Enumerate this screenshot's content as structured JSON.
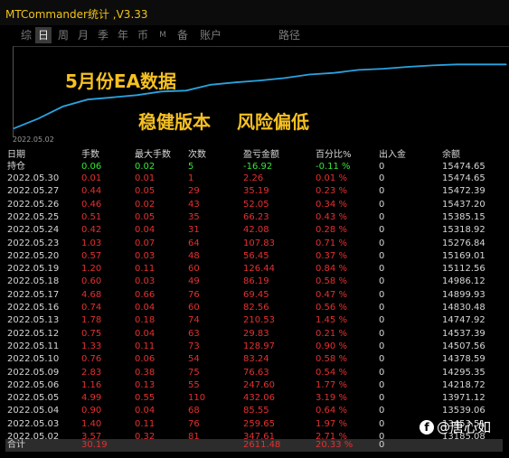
{
  "window": {
    "title": "MTCommander统计 ,V3.33"
  },
  "tabs": [
    {
      "label": "综",
      "active": false
    },
    {
      "label": "日",
      "active": true
    },
    {
      "label": "周",
      "active": false
    },
    {
      "label": "月",
      "active": false
    },
    {
      "label": "季",
      "active": false
    },
    {
      "label": "年",
      "active": false
    },
    {
      "label": "币",
      "active": false
    },
    {
      "label": "M",
      "active": false
    },
    {
      "label": "备",
      "active": false
    },
    {
      "label": "账户",
      "active": false
    },
    {
      "label": "路径",
      "active": false
    }
  ],
  "annotations": {
    "line1": "5月份EA数据",
    "line2a": "稳健版本",
    "line2b": "风险偏低"
  },
  "chart_data": {
    "type": "line",
    "x_start_label": "2022.05.02",
    "x": [
      "2022.05.02",
      "2022.05.03",
      "2022.05.04",
      "2022.05.05",
      "2022.05.06",
      "2022.05.09",
      "2022.05.10",
      "2022.05.11",
      "2022.05.12",
      "2022.05.13",
      "2022.05.16",
      "2022.05.17",
      "2022.05.18",
      "2022.05.19",
      "2022.05.20",
      "2022.05.23",
      "2022.05.24",
      "2022.05.25",
      "2022.05.26",
      "2022.05.27",
      "2022.05.30"
    ],
    "y": [
      13185.08,
      13539.06,
      13971.12,
      14218.72,
      14295.35,
      14378.59,
      14507.56,
      14537.39,
      14747.92,
      14830.48,
      14899.93,
      14986.12,
      15112.56,
      15169.01,
      15276.84,
      15318.92,
      15385.15,
      15437.2,
      15472.39,
      15474.65,
      15474.65
    ],
    "color": "#2aa3e0"
  },
  "table": {
    "headers": {
      "date": "日期",
      "lots": "手数",
      "max_lots": "最大手数",
      "count": "次数",
      "pnl": "盈亏金额",
      "pct": "百分比%",
      "io": "出入金",
      "balance": "余额"
    },
    "position_row": {
      "date": "持仓",
      "lots": "0.06",
      "max_lots": "0.02",
      "count": "5",
      "pnl": "-16.92",
      "pct": "-0.11 %",
      "io": "0",
      "balance": "15474.65"
    },
    "rows": [
      {
        "date": "2022.05.30",
        "lots": "0.01",
        "max_lots": "0.01",
        "count": "1",
        "pnl": "2.26",
        "pct": "0.01 %",
        "io": "0",
        "balance": "15474.65"
      },
      {
        "date": "2022.05.27",
        "lots": "0.44",
        "max_lots": "0.05",
        "count": "29",
        "pnl": "35.19",
        "pct": "0.23 %",
        "io": "0",
        "balance": "15472.39"
      },
      {
        "date": "2022.05.26",
        "lots": "0.46",
        "max_lots": "0.02",
        "count": "43",
        "pnl": "52.05",
        "pct": "0.34 %",
        "io": "0",
        "balance": "15437.20"
      },
      {
        "date": "2022.05.25",
        "lots": "0.51",
        "max_lots": "0.05",
        "count": "35",
        "pnl": "66.23",
        "pct": "0.43 %",
        "io": "0",
        "balance": "15385.15"
      },
      {
        "date": "2022.05.24",
        "lots": "0.42",
        "max_lots": "0.04",
        "count": "31",
        "pnl": "42.08",
        "pct": "0.28 %",
        "io": "0",
        "balance": "15318.92"
      },
      {
        "date": "2022.05.23",
        "lots": "1.03",
        "max_lots": "0.07",
        "count": "64",
        "pnl": "107.83",
        "pct": "0.71 %",
        "io": "0",
        "balance": "15276.84"
      },
      {
        "date": "2022.05.20",
        "lots": "0.57",
        "max_lots": "0.03",
        "count": "48",
        "pnl": "56.45",
        "pct": "0.37 %",
        "io": "0",
        "balance": "15169.01"
      },
      {
        "date": "2022.05.19",
        "lots": "1.20",
        "max_lots": "0.11",
        "count": "60",
        "pnl": "126.44",
        "pct": "0.84 %",
        "io": "0",
        "balance": "15112.56"
      },
      {
        "date": "2022.05.18",
        "lots": "0.60",
        "max_lots": "0.03",
        "count": "49",
        "pnl": "86.19",
        "pct": "0.58 %",
        "io": "0",
        "balance": "14986.12"
      },
      {
        "date": "2022.05.17",
        "lots": "4.68",
        "max_lots": "0.66",
        "count": "76",
        "pnl": "69.45",
        "pct": "0.47 %",
        "io": "0",
        "balance": "14899.93"
      },
      {
        "date": "2022.05.16",
        "lots": "0.74",
        "max_lots": "0.04",
        "count": "60",
        "pnl": "82.56",
        "pct": "0.56 %",
        "io": "0",
        "balance": "14830.48"
      },
      {
        "date": "2022.05.13",
        "lots": "1.78",
        "max_lots": "0.18",
        "count": "74",
        "pnl": "210.53",
        "pct": "1.45 %",
        "io": "0",
        "balance": "14747.92"
      },
      {
        "date": "2022.05.12",
        "lots": "0.75",
        "max_lots": "0.04",
        "count": "63",
        "pnl": "29.83",
        "pct": "0.21 %",
        "io": "0",
        "balance": "14537.39"
      },
      {
        "date": "2022.05.11",
        "lots": "1.33",
        "max_lots": "0.11",
        "count": "73",
        "pnl": "128.97",
        "pct": "0.90 %",
        "io": "0",
        "balance": "14507.56"
      },
      {
        "date": "2022.05.10",
        "lots": "0.76",
        "max_lots": "0.06",
        "count": "54",
        "pnl": "83.24",
        "pct": "0.58 %",
        "io": "0",
        "balance": "14378.59"
      },
      {
        "date": "2022.05.09",
        "lots": "2.83",
        "max_lots": "0.38",
        "count": "75",
        "pnl": "76.63",
        "pct": "0.54 %",
        "io": "0",
        "balance": "14295.35"
      },
      {
        "date": "2022.05.06",
        "lots": "1.16",
        "max_lots": "0.13",
        "count": "55",
        "pnl": "247.60",
        "pct": "1.77 %",
        "io": "0",
        "balance": "14218.72"
      },
      {
        "date": "2022.05.05",
        "lots": "4.99",
        "max_lots": "0.55",
        "count": "110",
        "pnl": "432.06",
        "pct": "3.19 %",
        "io": "0",
        "balance": "13971.12"
      },
      {
        "date": "2022.05.04",
        "lots": "0.90",
        "max_lots": "0.04",
        "count": "68",
        "pnl": "85.55",
        "pct": "0.64 %",
        "io": "0",
        "balance": "13539.06"
      },
      {
        "date": "2022.05.03",
        "lots": "1.40",
        "max_lots": "0.11",
        "count": "76",
        "pnl": "259.65",
        "pct": "1.97 %",
        "io": "0",
        "balance": "13453.51"
      },
      {
        "date": "2022.05.02",
        "lots": "3.57",
        "max_lots": "0.32",
        "count": "81",
        "pnl": "347.61",
        "pct": "2.71 %",
        "io": "0",
        "balance": "13185.08"
      }
    ],
    "total_row": {
      "date": "合计",
      "lots": "30.19",
      "max_lots": "",
      "count": "",
      "pnl": "2611.48",
      "pct": "20.33 %",
      "io": "0",
      "balance": ""
    }
  },
  "watermark": {
    "icon": "facebook-icon",
    "text": "@唐心如"
  },
  "colors": {
    "positive": "#35e635",
    "negative": "#e53030",
    "title": "#f0c419",
    "annotation": "#f5c022",
    "line": "#2aa3e0"
  }
}
